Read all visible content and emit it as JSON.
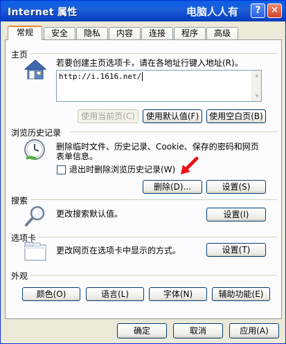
{
  "window": {
    "title": "Internet 属性",
    "watermark": "电脑人人有",
    "help_label": "?",
    "close_label": "✕"
  },
  "tabs": [
    {
      "label": "常规",
      "active": true
    },
    {
      "label": "安全"
    },
    {
      "label": "隐私"
    },
    {
      "label": "内容"
    },
    {
      "label": "连接"
    },
    {
      "label": "程序"
    },
    {
      "label": "高级"
    }
  ],
  "homepage": {
    "section": "主页",
    "description": "若要创建主页选项卡，请在各地址行键入地址(R)。",
    "url": "http://i.1616.net/",
    "buttons": {
      "use_current": "使用当前页(C)",
      "use_default": "使用默认值(F)",
      "use_blank": "使用空白页(B)"
    }
  },
  "history": {
    "section": "浏览历史记录",
    "description_line1": "删除临时文件、历史记录、Cookie、保存的密码和网页",
    "description_line2": "表单信息。",
    "checkbox_label": "退出时删除浏览历史记录(W)",
    "checkbox_checked": false,
    "delete_button": "删除(D)...",
    "settings_button": "设置(S)"
  },
  "search": {
    "section": "搜索",
    "description": "更改搜索默认值。",
    "settings_button": "设置(I)"
  },
  "tabs_section": {
    "section": "选项卡",
    "description": "更改网页在选项卡中显示的方式。",
    "settings_button": "设置(T)"
  },
  "appearance": {
    "section": "外观",
    "colors_button": "颜色(O)",
    "languages_button": "语言(L)",
    "fonts_button": "字体(N)",
    "accessibility_button": "辅助功能(E)"
  },
  "footer": {
    "ok": "确定",
    "cancel": "取消",
    "apply": "应用(A)"
  },
  "colors": {
    "titlebar": "#0c47c9",
    "annotation_arrow": "#e8141b"
  }
}
